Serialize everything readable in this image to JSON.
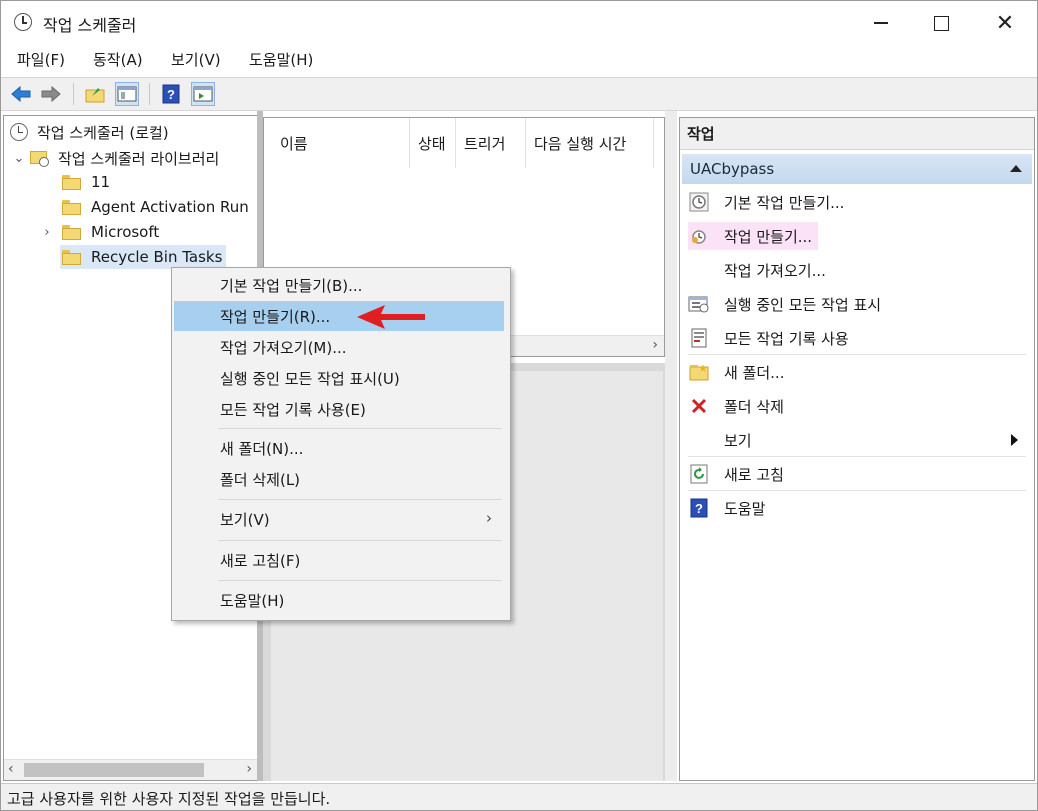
{
  "window": {
    "title": "작업 스케줄러"
  },
  "menubar": [
    "파일(F)",
    "동작(A)",
    "보기(V)",
    "도움말(H)"
  ],
  "tree": {
    "root": "작업 스케줄러 (로컬)",
    "library": "작업 스케줄러 라이브러리",
    "folders": [
      "11",
      "Agent Activation Run",
      "Microsoft",
      "Recycle Bin Tasks"
    ]
  },
  "table": {
    "columns": [
      "이름",
      "상태",
      "트리거",
      "다음 실행 시간"
    ]
  },
  "context_menu": {
    "items": [
      "기본 작업 만들기(B)...",
      "작업 만들기(R)...",
      "작업 가져오기(M)...",
      "실행 중인 모든 작업 표시(U)",
      "모든 작업 기록 사용(E)",
      "새 폴더(N)...",
      "폴더 삭제(L)",
      "보기(V)",
      "새로 고침(F)",
      "도움말(H)"
    ],
    "highlighted": "작업 만들기(R)..."
  },
  "actions": {
    "header": "작업",
    "section": "UACbypass",
    "items": [
      "기본 작업 만들기...",
      "작업 만들기...",
      "작업 가져오기...",
      "실행 중인 모든 작업 표시",
      "모든 작업 기록 사용",
      "새 폴더...",
      "폴더 삭제",
      "보기",
      "새로 고침",
      "도움말"
    ]
  },
  "status": {
    "text": "고급 사용자를 위한 사용자 지정된 작업을 만듭니다."
  },
  "colors": {
    "highlight": "#a6cff0",
    "arrow": "#e02020",
    "action_highlight": "#fbe2f6"
  }
}
